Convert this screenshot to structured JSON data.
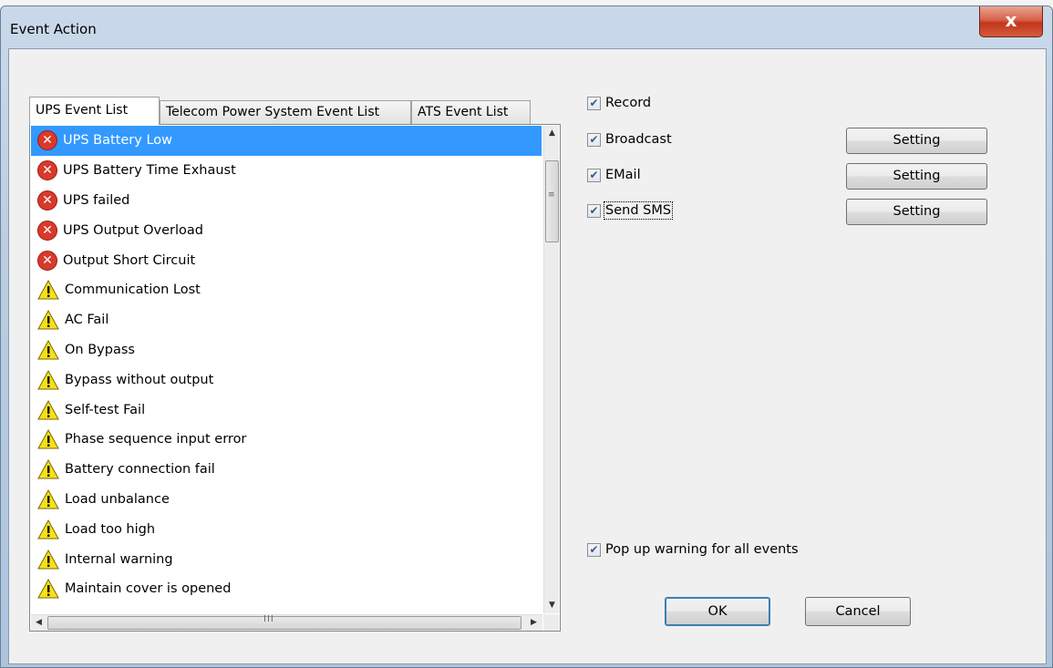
{
  "window": {
    "title": "Event Action",
    "close_glyph": "x"
  },
  "tabs": [
    {
      "label": "UPS Event List",
      "active": true
    },
    {
      "label": "Telecom Power System Event List",
      "active": false
    },
    {
      "label": "ATS Event List",
      "active": false
    }
  ],
  "events": [
    {
      "label": "UPS Battery Low",
      "icon": "error-icon",
      "selected": true
    },
    {
      "label": "UPS Battery Time Exhaust",
      "icon": "error-icon"
    },
    {
      "label": "UPS failed",
      "icon": "error-icon"
    },
    {
      "label": "UPS Output Overload",
      "icon": "error-icon"
    },
    {
      "label": "Output Short Circuit",
      "icon": "error-icon"
    },
    {
      "label": "Communication Lost",
      "icon": "warning-icon"
    },
    {
      "label": "AC Fail",
      "icon": "warning-icon"
    },
    {
      "label": "On Bypass",
      "icon": "warning-icon"
    },
    {
      "label": "Bypass without output",
      "icon": "warning-icon"
    },
    {
      "label": "Self-test Fail",
      "icon": "warning-icon"
    },
    {
      "label": "Phase sequence input error",
      "icon": "warning-icon"
    },
    {
      "label": "Battery connection fail",
      "icon": "warning-icon"
    },
    {
      "label": "Load unbalance",
      "icon": "warning-icon"
    },
    {
      "label": "Load too high",
      "icon": "warning-icon"
    },
    {
      "label": "Internal warning",
      "icon": "warning-icon"
    },
    {
      "label": "Maintain cover is opened",
      "icon": "warning-icon"
    }
  ],
  "actions": {
    "record": {
      "label": "Record",
      "checked": true
    },
    "broadcast": {
      "label": "Broadcast",
      "checked": true,
      "setting_label": "Setting"
    },
    "email": {
      "label": "EMail",
      "checked": true,
      "setting_label": "Setting"
    },
    "sms": {
      "label": "Send SMS",
      "checked": true,
      "setting_label": "Setting"
    }
  },
  "popup_warning": {
    "label": "Pop up warning for all events",
    "checked": true
  },
  "buttons": {
    "ok": "OK",
    "cancel": "Cancel"
  },
  "scrollbar": {
    "vgrip": "≡",
    "hgrip": "III"
  },
  "colors": {
    "selection": "#3399ff",
    "error": "#d83a2c",
    "warning": "#f7e017"
  }
}
